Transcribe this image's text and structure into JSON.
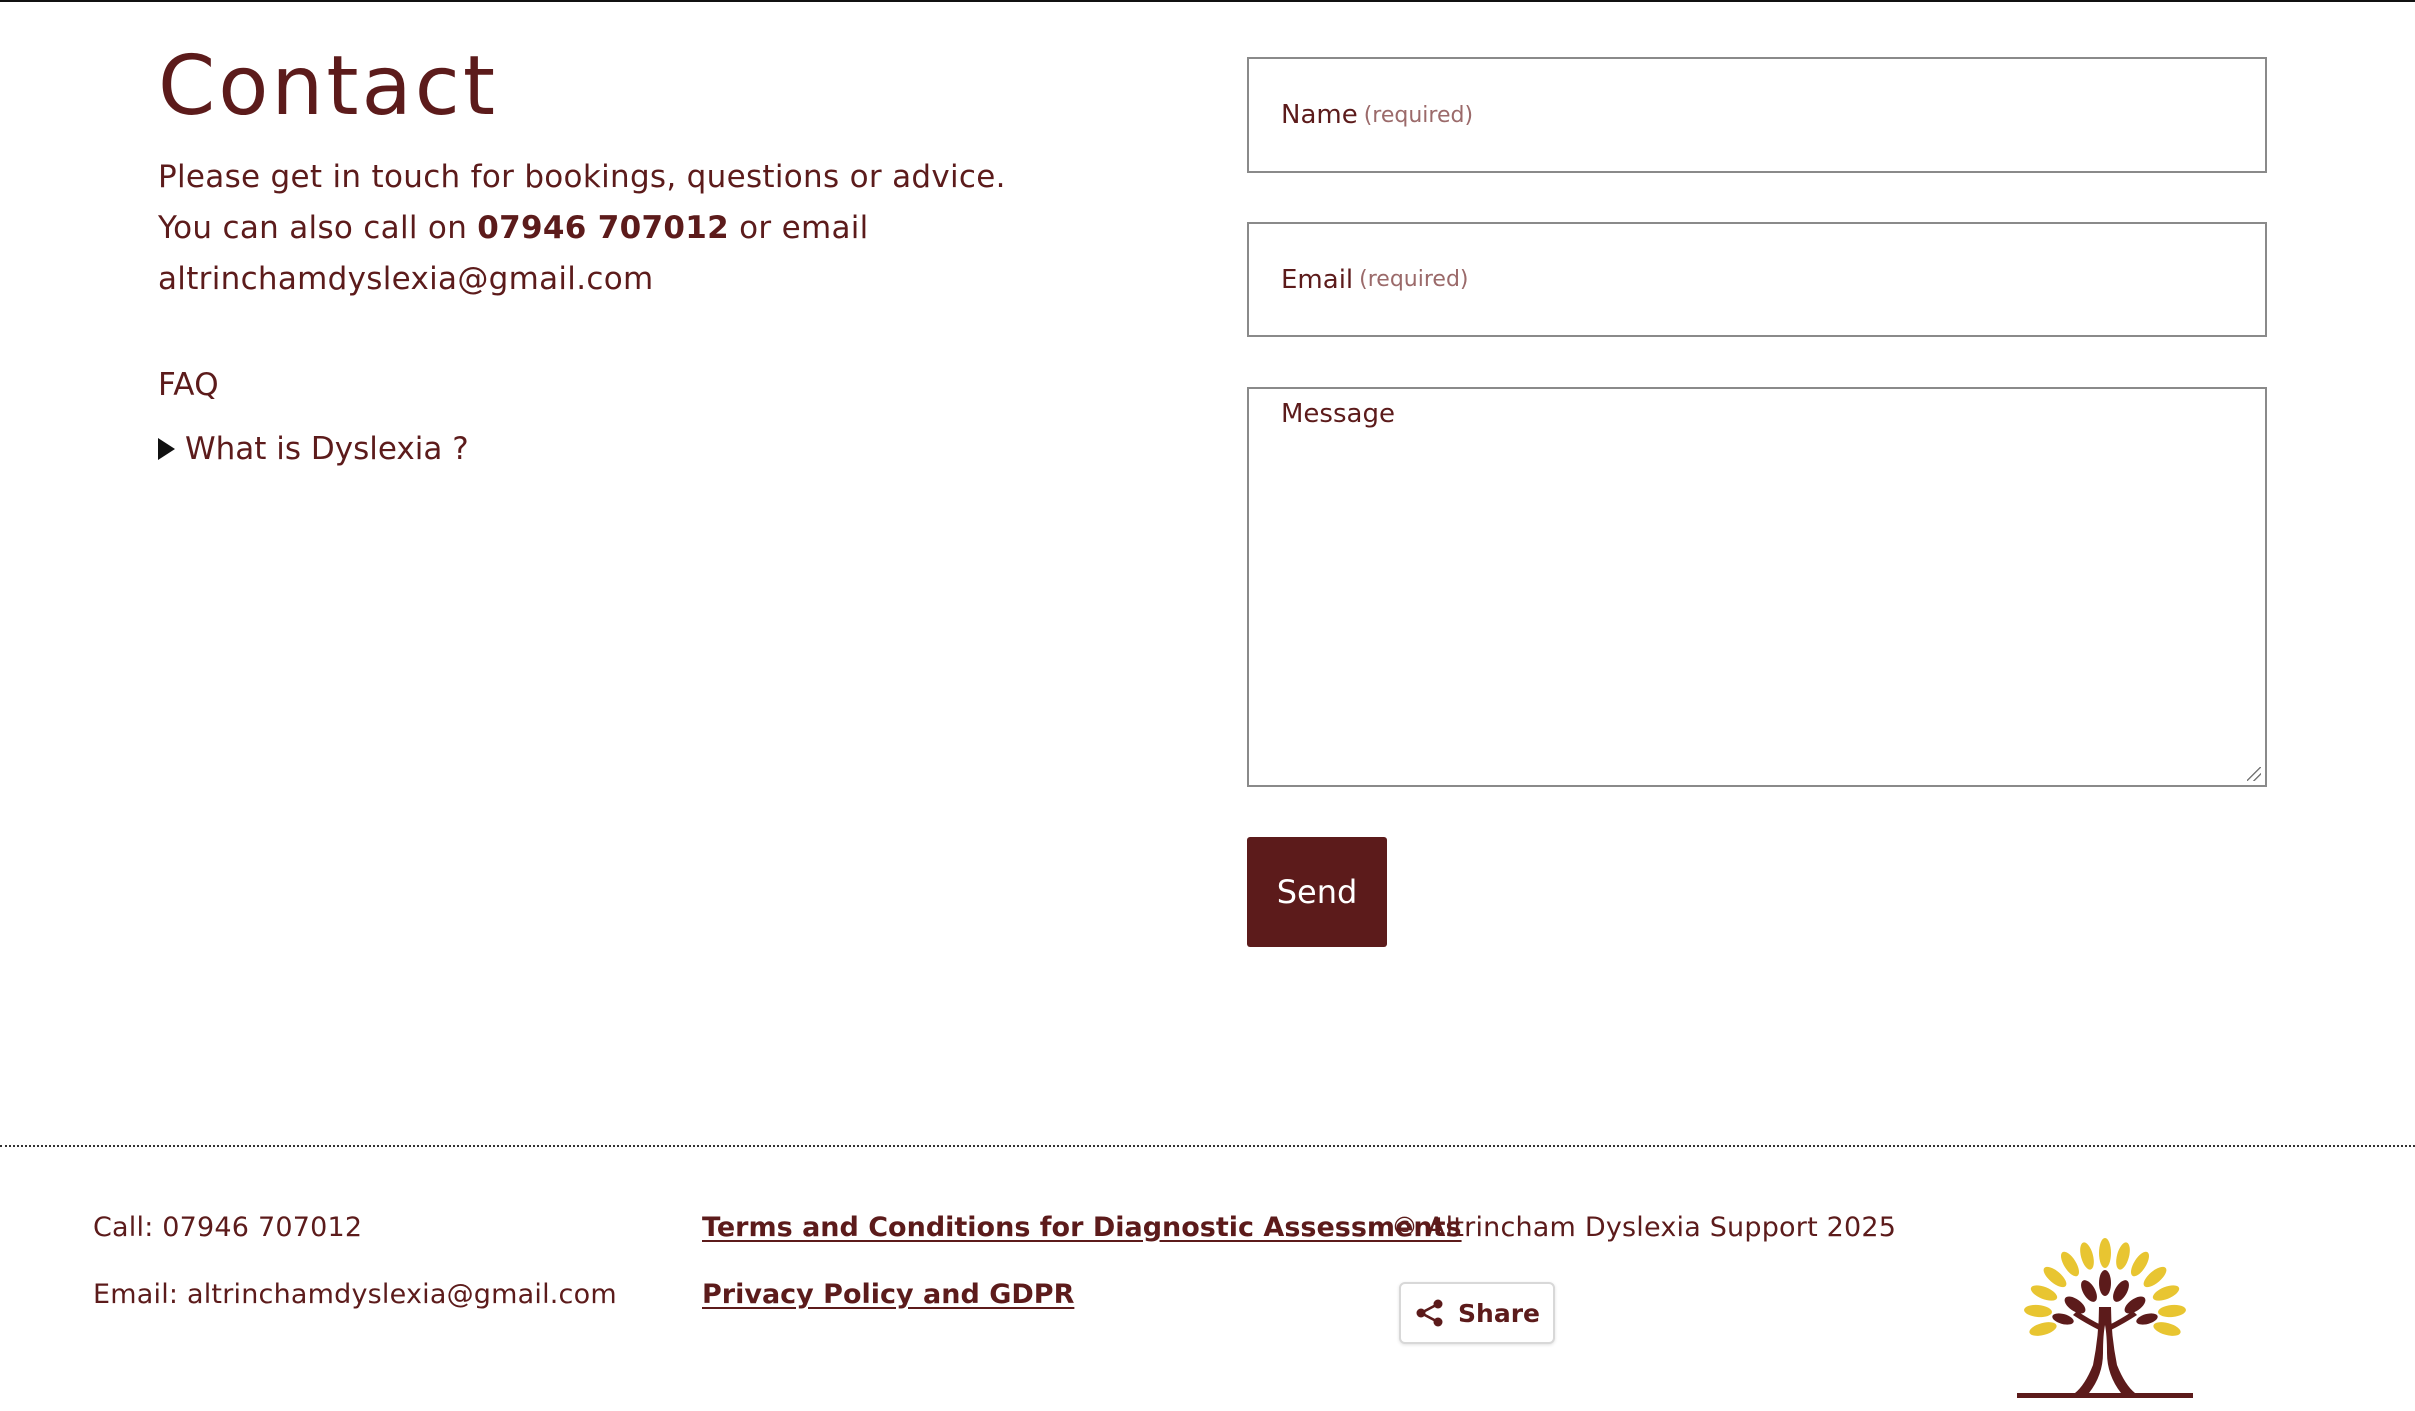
{
  "contact": {
    "title": "Contact",
    "intro_line1": "Please get in touch for bookings, questions or advice.",
    "intro_line2_prefix": "You can also call on ",
    "phone": "07946 707012",
    "intro_line2_suffix": " or email",
    "email": "altrinchamdyslexia@gmail.com",
    "faq_heading": "FAQ",
    "faq_items": [
      {
        "question": "What is Dyslexia ?"
      }
    ]
  },
  "form": {
    "name_label": "Name",
    "email_label": "Email",
    "required_tag": "(required)",
    "message_label": "Message",
    "send_label": "Send"
  },
  "footer": {
    "call_text": "Call: 07946 707012",
    "email_text": "Email: altrinchamdyslexia@gmail.com",
    "terms_link": "Terms and Conditions for Diagnostic Assessments",
    "privacy_link": "Privacy Policy and GDPR",
    "copyright": "© Altrincham Dyslexia Support 2025",
    "share_label": "Share",
    "logo_icon": "tree-logo-icon"
  },
  "colors": {
    "brand": "#5c1b1b",
    "leaf_yellow": "#e8c531",
    "background": "#ffffff"
  }
}
